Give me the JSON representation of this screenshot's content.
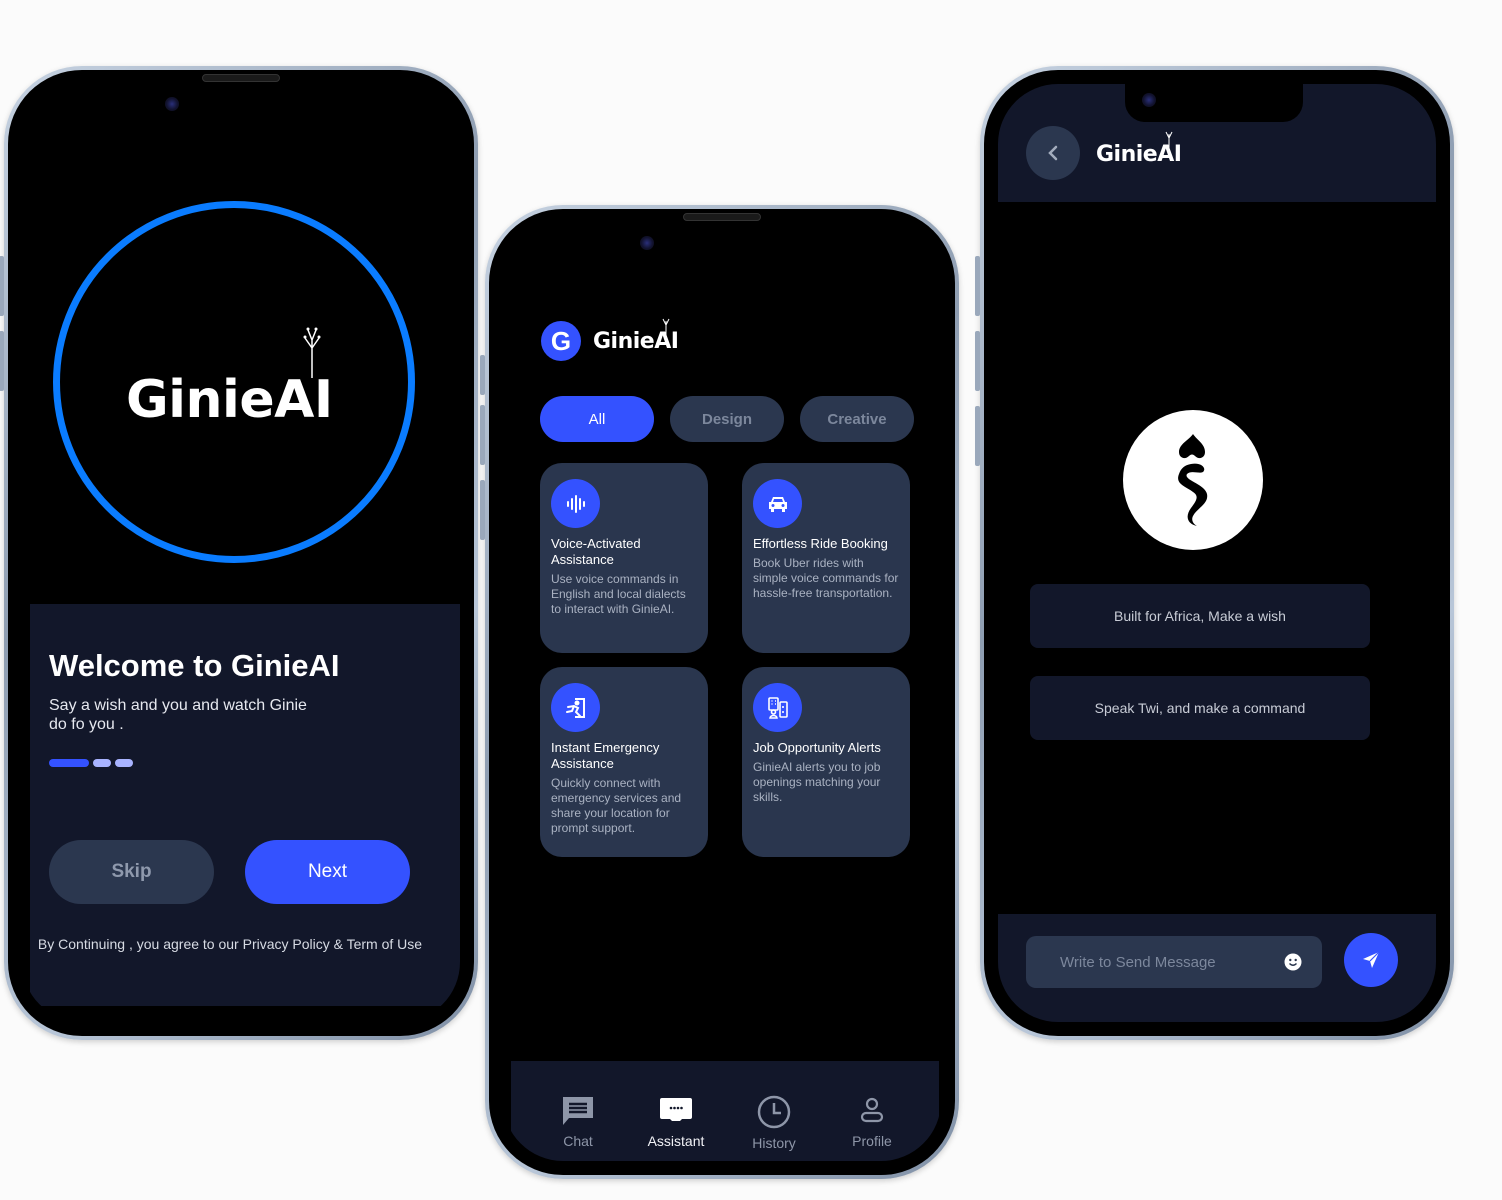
{
  "app_name": "GinieAI",
  "colors": {
    "accent": "#3452ff",
    "ring": "#0a7cff",
    "panel": "#12172a",
    "card": "#2a364e",
    "chip": "#2b374f"
  },
  "onboarding": {
    "logo_text": "GinieAI",
    "title": "Welcome to GinieAI",
    "subtitle": "Say a wish and you  and watch Ginie do fo you .",
    "page_indicator": {
      "total": 3,
      "current": 1
    },
    "skip_label": "Skip",
    "next_label": "Next",
    "terms": "By Continuing , you agree to our Privacy Policy & Term of Use"
  },
  "assistant": {
    "badge_letter": "G",
    "logo_text": "GinieAI",
    "filters": [
      {
        "label": "All",
        "active": true
      },
      {
        "label": "Design",
        "active": false
      },
      {
        "label": "Creative",
        "active": false
      }
    ],
    "cards": [
      {
        "icon": "voice-wave-icon",
        "title": "Voice-Activated Assistance",
        "desc": "Use voice commands in English and local dialects to interact with GinieAI."
      },
      {
        "icon": "car-icon",
        "title": "Effortless Ride Booking",
        "desc": "Book Uber rides with simple voice commands for hassle-free transportation."
      },
      {
        "icon": "emergency-exit-icon",
        "title": "Instant Emergency Assistance",
        "desc": "Quickly connect with emergency services and share your location for prompt support."
      },
      {
        "icon": "job-building-icon",
        "title": "Job Opportunity Alerts",
        "desc": "GinieAI alerts you to job openings matching your skills."
      }
    ],
    "tabs": [
      {
        "label": "Chat",
        "icon": "chat-icon",
        "active": false
      },
      {
        "label": "Assistant",
        "icon": "assistant-icon",
        "active": true
      },
      {
        "label": "History",
        "icon": "clock-icon",
        "active": false
      },
      {
        "label": "Profile",
        "icon": "profile-icon",
        "active": false
      }
    ]
  },
  "chat": {
    "logo_text": "GinieAI",
    "suggestions": [
      "Built for Africa, Make a wish",
      "Speak Twi, and make a command"
    ],
    "input_placeholder": "Write to Send Message",
    "input_value": ""
  }
}
